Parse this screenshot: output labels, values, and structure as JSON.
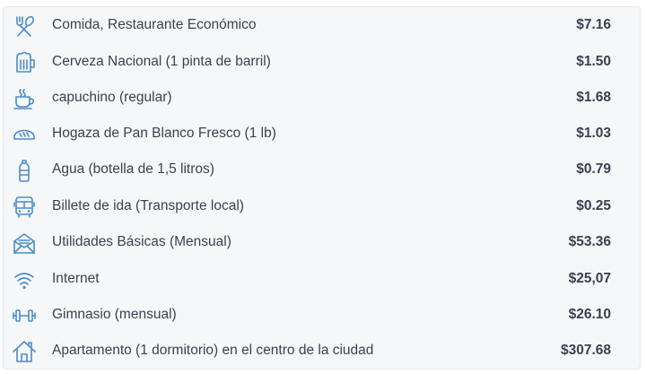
{
  "accent_color": "#4a8cc9",
  "items": [
    {
      "icon": "cutlery-icon",
      "label": "Comida, Restaurante Económico",
      "price": "$7.16"
    },
    {
      "icon": "beer-mug-icon",
      "label": "Cerveza Nacional (1 pinta de barril)",
      "price": "$1.50"
    },
    {
      "icon": "coffee-cup-icon",
      "label": "capuchino (regular)",
      "price": "$1.68"
    },
    {
      "icon": "bread-icon",
      "label": "Hogaza de Pan Blanco Fresco (1 lb)",
      "price": "$1.03"
    },
    {
      "icon": "water-bottle-icon",
      "label": "Agua (botella de 1,5 litros)",
      "price": "$0.79"
    },
    {
      "icon": "bus-icon",
      "label": "Billete de ida (Transporte local)",
      "price": "$0.25"
    },
    {
      "icon": "utilities-envelope-icon",
      "label": "Utilidades Básicas (Mensual)",
      "price": "$53.36"
    },
    {
      "icon": "wifi-icon",
      "label": "Internet",
      "price": "$25,07"
    },
    {
      "icon": "dumbbell-icon",
      "label": "Gimnasio (mensual)",
      "price": "$26.10"
    },
    {
      "icon": "house-icon",
      "label": "Apartamento (1 dormitorio) en el centro de la ciudad",
      "price": "$307.68"
    }
  ]
}
